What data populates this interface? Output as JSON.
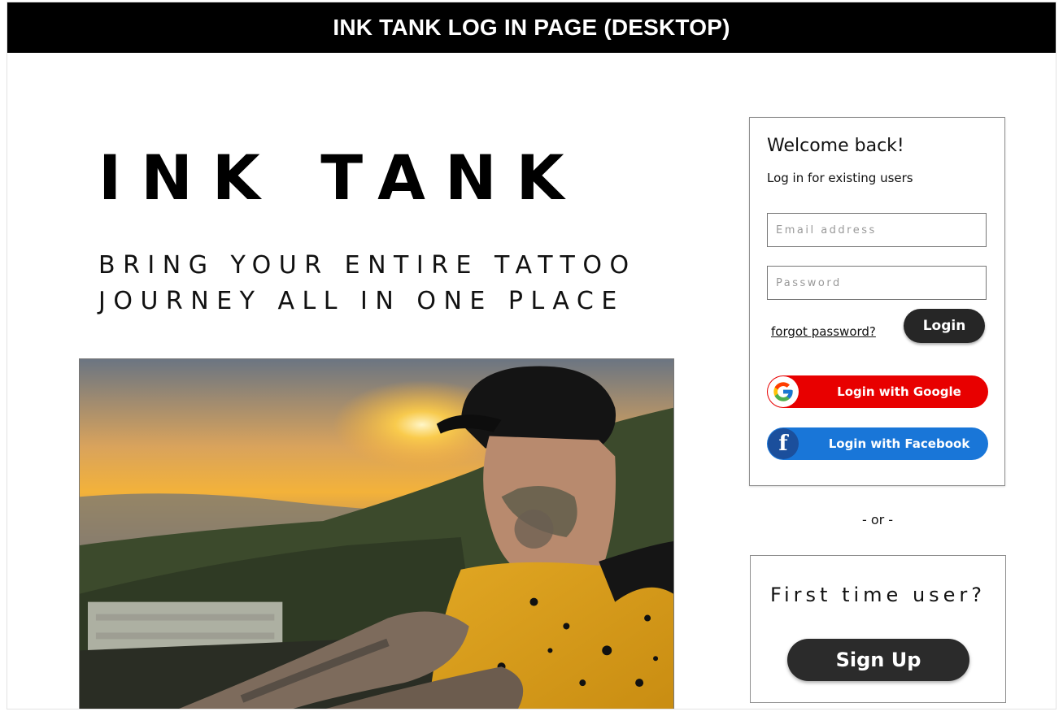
{
  "banner": {
    "title": "INK TANK LOG IN PAGE (DESKTOP)"
  },
  "brand": {
    "title": "INK TANK",
    "tagline_line1": "BRING YOUR ENTIRE TATTOO",
    "tagline_line2": "JOURNEY ALL IN ONE PLACE"
  },
  "login": {
    "welcome": "Welcome back!",
    "subtitle": "Log in for existing users",
    "email_placeholder": "Email address",
    "password_placeholder": "Password",
    "forgot_label": "forgot password?",
    "login_label": "Login",
    "google_label": "Login with Google",
    "facebook_label": "Login with Facebook",
    "facebook_glyph": "f"
  },
  "separator": {
    "text": "- or -"
  },
  "signup": {
    "prompt": "First time user?",
    "button_label": "Sign Up"
  },
  "colors": {
    "banner_bg": "#000000",
    "google_red": "#e80000",
    "facebook_blue": "#1976d8",
    "button_dark": "#262626"
  },
  "icons": {
    "google": "google-logo-icon",
    "facebook": "facebook-logo-icon",
    "hero": "hero-photo-tattooed-man-sunset"
  }
}
